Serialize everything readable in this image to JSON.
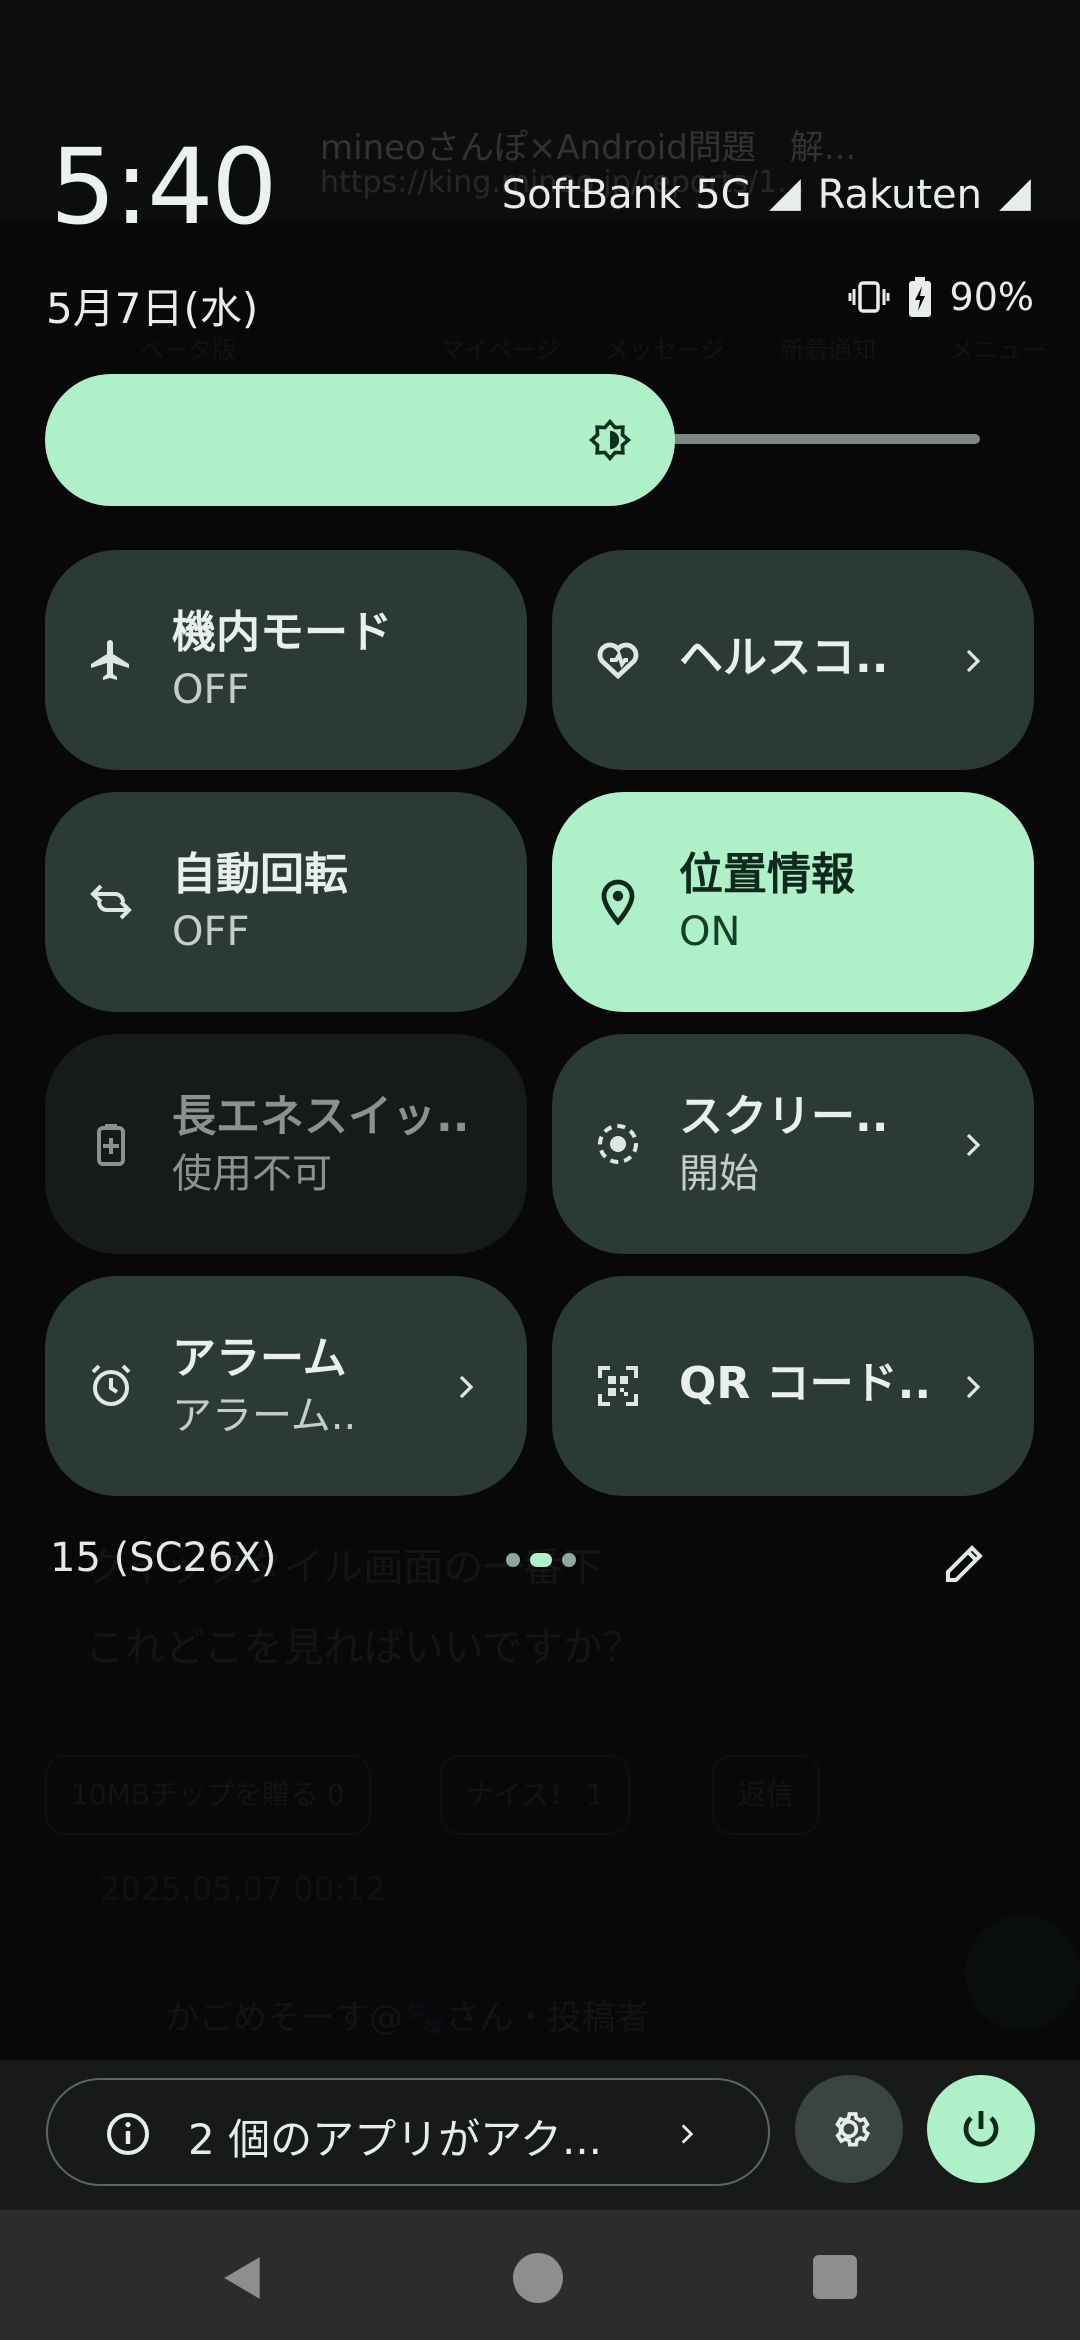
{
  "background_app": {
    "title": "mineoさんぽ×Android問題　解...",
    "url": "https://king.mineo.jp/reports/1...",
    "nav_items": [
      "マイページ",
      "メッセージ",
      "新着通知",
      "メニュー"
    ],
    "logo_sub": "ベータ版",
    "comment_lines": [
      "クイックタイル画面の一番下",
      "これどこを見ればいいですか？"
    ],
    "chips": [
      "10MBチップを贈る 0",
      "ナイス！ 1",
      "返信"
    ],
    "date": "2025.05.07 00:12",
    "author": "かごめそーす@🐾さん・投稿者"
  },
  "status": {
    "time": "5:40",
    "date": "5月7日(水)",
    "carrier1": "SoftBank",
    "network1": "5G",
    "carrier2": "Rakuten",
    "battery": "90%"
  },
  "brightness": {
    "level": 0.64
  },
  "tiles": [
    {
      "id": "airplane",
      "title": "機内モード",
      "subtitle": "OFF",
      "state": "off",
      "icon": "airplane-icon",
      "chevron": false
    },
    {
      "id": "health",
      "title": "ヘルスコ..",
      "subtitle": "",
      "state": "off",
      "icon": "health-connect-icon",
      "chevron": true
    },
    {
      "id": "rotate",
      "title": "自動回転",
      "subtitle": "OFF",
      "state": "off",
      "icon": "auto-rotate-icon",
      "chevron": false
    },
    {
      "id": "location",
      "title": "位置情報",
      "subtitle": "ON",
      "state": "on",
      "icon": "location-pin-icon",
      "chevron": false
    },
    {
      "id": "battery-saver",
      "title": "長エネスイッ..",
      "subtitle": "使用不可",
      "state": "unavailable",
      "icon": "battery-saver-icon",
      "chevron": false
    },
    {
      "id": "screen-record",
      "title": "スクリー..",
      "subtitle": "開始",
      "state": "off",
      "icon": "screen-record-icon",
      "chevron": true
    },
    {
      "id": "alarm",
      "title": "アラーム",
      "subtitle": "アラーム..",
      "state": "off",
      "icon": "alarm-clock-icon",
      "chevron": true
    },
    {
      "id": "qr",
      "title": "QR コード..",
      "subtitle": "",
      "state": "off",
      "icon": "qr-code-icon",
      "chevron": true
    }
  ],
  "footer": {
    "build": "15 (SC26X)",
    "pages": 3,
    "current_page": 2
  },
  "bottom": {
    "active_apps": "2 個のアプリがアク..."
  },
  "colors": {
    "accent": "#aef0c8",
    "tile": "#2c3a34",
    "tile_dim": "#161b19",
    "background": "#050505"
  }
}
